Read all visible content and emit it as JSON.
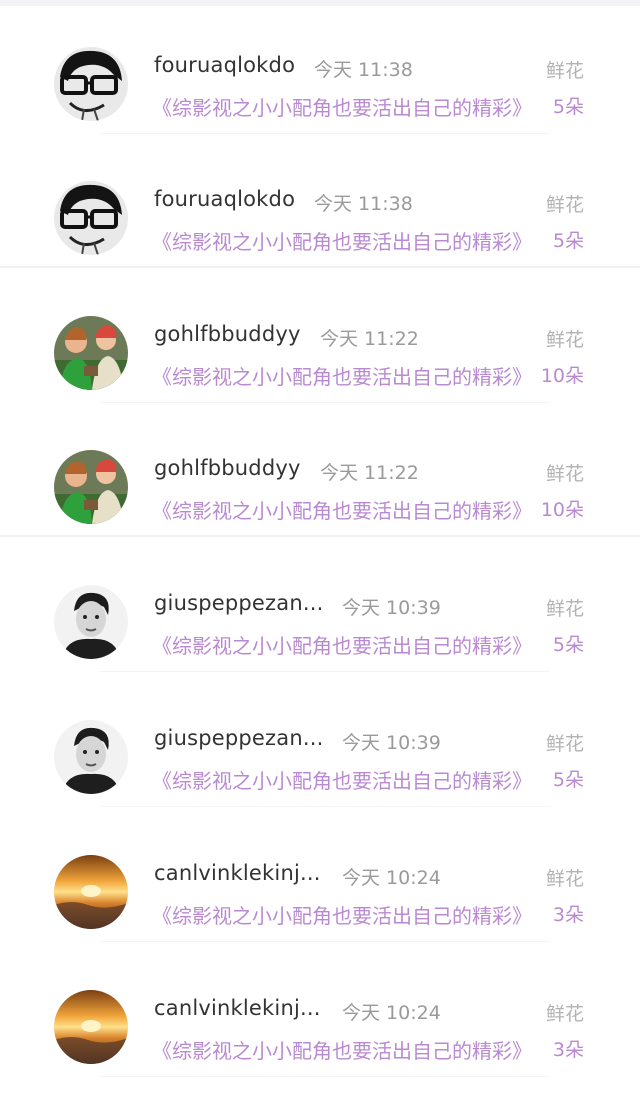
{
  "items": [
    {
      "user": "fouruaqlokdo",
      "time": "今天 11:38",
      "title": "《综影视之小小配角也要活出自己的精彩》",
      "label": "鲜花",
      "count": "5朵",
      "avatar_icon": "glasses-boy-avatar-icon"
    },
    {
      "user": "fouruaqlokdo",
      "time": "今天 11:38",
      "title": "《综影视之小小配角也要活出自己的精彩》",
      "label": "鲜花",
      "count": "5朵",
      "avatar_icon": "glasses-boy-avatar-icon"
    },
    {
      "user": "gohlfbbuddyy",
      "time": "今天 11:22",
      "title": "《综影视之小小配角也要活出自己的精彩》",
      "label": "鲜花",
      "count": "10朵",
      "avatar_icon": "two-kids-photo-avatar-icon"
    },
    {
      "user": "gohlfbbuddyy",
      "time": "今天 11:22",
      "title": "《综影视之小小配角也要活出自己的精彩》",
      "label": "鲜花",
      "count": "10朵",
      "avatar_icon": "two-kids-photo-avatar-icon"
    },
    {
      "user": "giuspeppezan...",
      "time": "今天 10:39",
      "title": "《综影视之小小配角也要活出自己的精彩》",
      "label": "鲜花",
      "count": "5朵",
      "avatar_icon": "young-man-bw-avatar-icon"
    },
    {
      "user": "giuspeppezan...",
      "time": "今天 10:39",
      "title": "《综影视之小小配角也要活出自己的精彩》",
      "label": "鲜花",
      "count": "5朵",
      "avatar_icon": "young-man-bw-avatar-icon"
    },
    {
      "user": "canlvinklekinj...",
      "time": "今天 10:24",
      "title": "《综影视之小小配角也要活出自己的精彩》",
      "label": "鲜花",
      "count": "3朵",
      "avatar_icon": "sunset-clouds-avatar-icon"
    },
    {
      "user": "canlvinklekinj...",
      "time": "今天 10:24",
      "title": "《综影视之小小配角也要活出自己的精彩》",
      "label": "鲜花",
      "count": "3朵",
      "avatar_icon": "sunset-clouds-avatar-icon"
    }
  ]
}
